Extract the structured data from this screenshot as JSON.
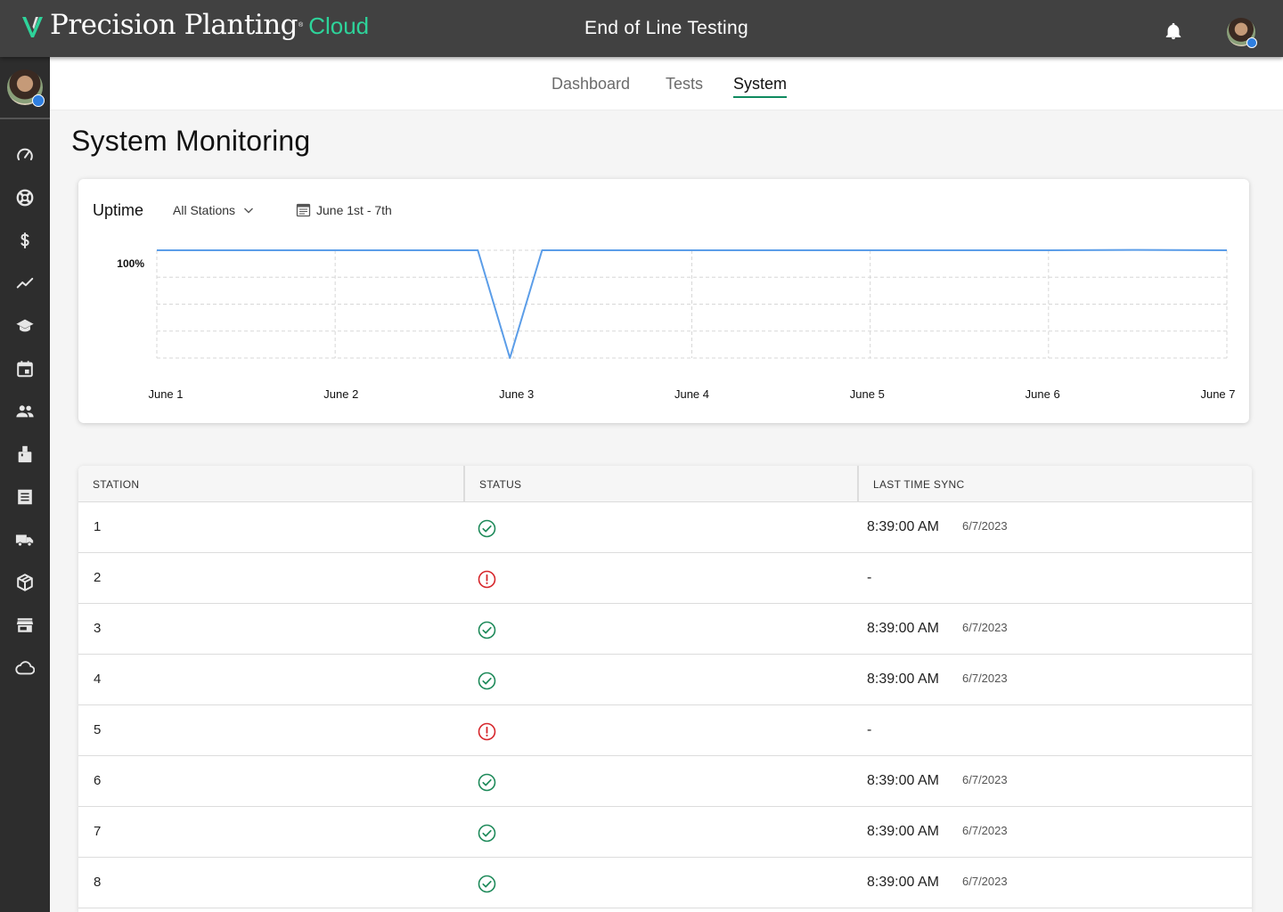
{
  "header": {
    "brand_name": "Precision Planting",
    "brand_tm": "®",
    "brand_suffix": "Cloud",
    "app_title": "End of Line Testing",
    "brand_color": "#2ed39a"
  },
  "sidebar": {
    "items": [
      {
        "icon": "speedometer-icon"
      },
      {
        "icon": "lifebuoy-icon"
      },
      {
        "icon": "dollar-icon"
      },
      {
        "icon": "trending-line-icon"
      },
      {
        "icon": "graduation-cap-icon"
      },
      {
        "icon": "calendar-icon"
      },
      {
        "icon": "people-icon"
      },
      {
        "icon": "box-hand-icon"
      },
      {
        "icon": "receipt-icon"
      },
      {
        "icon": "truck-icon"
      },
      {
        "icon": "cube-icon"
      },
      {
        "icon": "store-icon"
      },
      {
        "icon": "cloud-icon"
      }
    ]
  },
  "tabs": [
    {
      "label": "Dashboard",
      "active": false
    },
    {
      "label": "Tests",
      "active": false
    },
    {
      "label": "System",
      "active": true
    }
  ],
  "page": {
    "title": "System Monitoring"
  },
  "uptime": {
    "title": "Uptime",
    "station_filter": "All Stations",
    "date_range": "June 1st - 7th"
  },
  "chart_data": {
    "type": "line",
    "title": "Uptime",
    "x": [
      "June 1",
      "June 2",
      "June 3",
      "June 4",
      "June 5",
      "June 6",
      "June 7"
    ],
    "y_ticks": [
      "100%"
    ],
    "ylim": [
      0,
      100
    ],
    "grid": true,
    "line_color": "#5b9de8",
    "series": [
      {
        "points": [
          {
            "x": 0,
            "y": 100
          },
          {
            "x": 1,
            "y": 100
          },
          {
            "x": 1.8,
            "y": 100
          },
          {
            "x": 1.98,
            "y": 0
          },
          {
            "x": 2.16,
            "y": 100
          },
          {
            "x": 3,
            "y": 100
          },
          {
            "x": 4,
            "y": 100
          },
          {
            "x": 5,
            "y": 100
          },
          {
            "x": 5.5,
            "y": 100.3
          },
          {
            "x": 6,
            "y": 100
          }
        ]
      }
    ]
  },
  "table": {
    "headers": [
      "STATION",
      "STATUS",
      "LAST TIME SYNC"
    ],
    "status_colors": {
      "ok": "#1e8a5a",
      "error": "#d6262b"
    },
    "rows": [
      {
        "station": "1",
        "status": "ok",
        "time": "8:39:00 AM",
        "date": "6/7/2023"
      },
      {
        "station": "2",
        "status": "error",
        "time": "-",
        "date": ""
      },
      {
        "station": "3",
        "status": "ok",
        "time": "8:39:00 AM",
        "date": "6/7/2023"
      },
      {
        "station": "4",
        "status": "ok",
        "time": "8:39:00 AM",
        "date": "6/7/2023"
      },
      {
        "station": "5",
        "status": "error",
        "time": "-",
        "date": ""
      },
      {
        "station": "6",
        "status": "ok",
        "time": "8:39:00 AM",
        "date": "6/7/2023"
      },
      {
        "station": "7",
        "status": "ok",
        "time": "8:39:00 AM",
        "date": "6/7/2023"
      },
      {
        "station": "8",
        "status": "ok",
        "time": "8:39:00 AM",
        "date": "6/7/2023"
      }
    ]
  }
}
